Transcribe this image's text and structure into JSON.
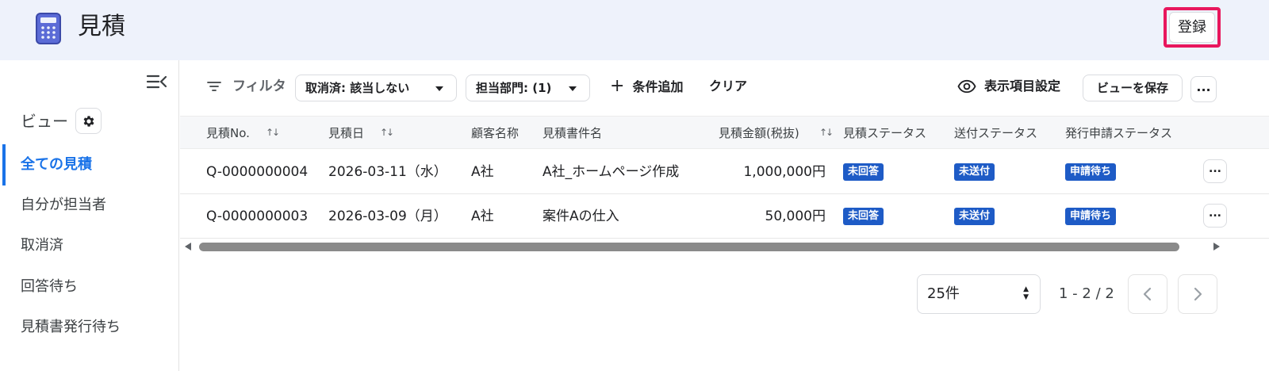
{
  "header": {
    "title": "見積",
    "register_label": "登録",
    "highlight_color": "#e8175d"
  },
  "sidebar": {
    "view_label": "ビュー",
    "items": [
      {
        "label": "全ての見積",
        "active": true
      },
      {
        "label": "自分が担当者"
      },
      {
        "label": "取消済"
      },
      {
        "label": "回答待ち"
      },
      {
        "label": "見積書発行待ち"
      }
    ]
  },
  "toolbar": {
    "filter_label": "フィルタ",
    "chips": [
      {
        "label": "取消済: 該当しない"
      },
      {
        "label": "担当部門: (1)"
      }
    ],
    "add_condition_label": "条件追加",
    "clear_label": "クリア",
    "display_settings_label": "表示項目設定",
    "save_view_label": "ビューを保存",
    "more_label": "..."
  },
  "table": {
    "columns": [
      "見積No.",
      "見積日",
      "顧客名称",
      "見積書件名",
      "見積金額(税抜)",
      "見積ステータス",
      "送付ステータス",
      "発行申請ステータス"
    ],
    "rows": [
      {
        "no": "Q-0000000004",
        "date": "2026-03-11（水）",
        "customer": "A社",
        "subject": "A社_ホームページ作成",
        "amount": "1,000,000円",
        "quote_status": "未回答",
        "send_status": "未送付",
        "issue_status": "申請待ち"
      },
      {
        "no": "Q-0000000003",
        "date": "2026-03-09（月）",
        "customer": "A社",
        "subject": "案件Aの仕入",
        "amount": "50,000円",
        "quote_status": "未回答",
        "send_status": "未送付",
        "issue_status": "申請待ち"
      }
    ],
    "row_more_label": "...",
    "badge_color": "#1e5bc6"
  },
  "pagination": {
    "page_size": "25件",
    "range": "1 - 2 / 2"
  },
  "colors": {
    "accent": "#1a73e8",
    "header_bg": "#eef2fb"
  }
}
